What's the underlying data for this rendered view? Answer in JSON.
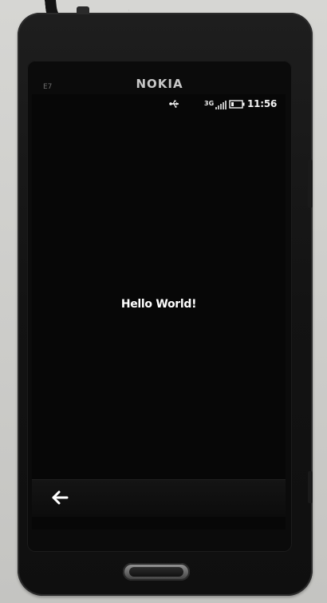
{
  "device": {
    "model_label": "E7",
    "brand": "NOKIA"
  },
  "status_bar": {
    "connection_icon": "usb-icon",
    "network": "3G",
    "signal_icon": "signal-strength-icon",
    "battery_icon": "battery-icon",
    "time": "11:56"
  },
  "app": {
    "message": "Hello World!"
  },
  "toolbar": {
    "back_icon": "back-arrow-icon"
  },
  "colors": {
    "screen_bg": "#070707",
    "text": "#ffffff",
    "phone_body": "#161616"
  }
}
